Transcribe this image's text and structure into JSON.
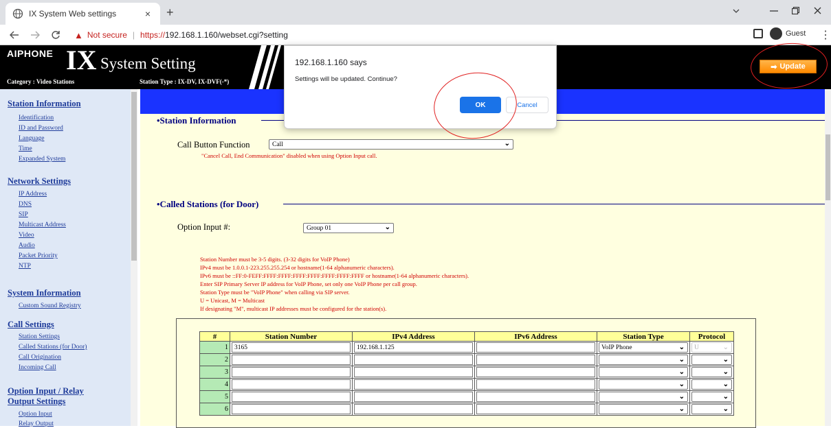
{
  "browser": {
    "tab_title": "IX System Web settings",
    "tab_close": "×",
    "new_tab": "+",
    "not_secure": "Not secure",
    "url_https": "https://",
    "url_rest": "192.168.1.160/webset.cgi?setting",
    "profile": "Guest",
    "icons": [
      "globe-icon",
      "back-icon",
      "forward-icon",
      "reload-icon",
      "warning-icon",
      "sidepanel-icon",
      "profile-icon",
      "menu-icon",
      "minimize-icon",
      "restore-icon",
      "close-icon",
      "dropdown-icon"
    ]
  },
  "header": {
    "brand": "AIPHONE",
    "product": "IX",
    "title": "System Setting",
    "category": "Category : Video Stations",
    "station_type": "Station Type : IX-DV, IX-DVF(-*)",
    "update_label": "Update"
  },
  "sidebar": {
    "sections": [
      {
        "title": "Station Information",
        "items": [
          "Identification",
          "ID and Password",
          "Language",
          "Time",
          "Expanded System"
        ]
      },
      {
        "title": "Network Settings",
        "items": [
          "IP Address",
          "DNS",
          "SIP",
          "Multicast Address",
          "Video",
          "Audio",
          "Packet Priority",
          "NTP"
        ]
      },
      {
        "title": "System Information",
        "items": [
          "Custom Sound Registry"
        ]
      },
      {
        "title": "Call Settings",
        "items": [
          "Station Settings",
          "Called Stations (for Door)",
          "Call Origination",
          "Incoming Call"
        ]
      },
      {
        "title": "Option Input / Relay Output Settings",
        "title_lines": [
          "Option Input / Relay",
          "Output Settings"
        ],
        "items": [
          "Option Input",
          "Relay Output"
        ]
      }
    ]
  },
  "main": {
    "station_info_title": "•Station Information",
    "call_button_label": "Call Button Function",
    "call_button_value": "Call",
    "call_note": "\"Cancel Call, End Communication\" disabled when using Option Input call.",
    "called_title": "•Called Stations (for Door)",
    "option_input_label": "Option Input #:",
    "option_input_value": "Group 01",
    "notes": [
      "Station Number must be 3-5 digits. (3-32 digits for VoIP Phone)",
      "IPv4 must be 1.0.0.1-223.255.255.254 or hostname(1-64 alphanumeric characters).",
      "IPv6 must be ::FF:0-FEFF:FFFF:FFFF:FFFF:FFFF:FFFF:FFFF:FFFF or hostname(1-64 alphanumeric characters).",
      "Enter SIP Primary Server IP address for VoIP Phone, set only one VoIP Phone per call group.",
      "Station Type must be \"VoIP Phone\" when calling via SIP server.",
      "U = Unicast, M = Multicast",
      "If designating \"M\", multicast IP addresses must be configured for the station(s)."
    ],
    "table": {
      "headers": [
        "#",
        "Station Number",
        "IPv4 Address",
        "IPv6 Address",
        "Station Type",
        "Protocol"
      ],
      "rows": [
        {
          "n": "1",
          "station": "3165",
          "ipv4": "192.168.1.125",
          "ipv6": "",
          "type": "VoIP Phone",
          "protocol": "U"
        },
        {
          "n": "2",
          "station": "",
          "ipv4": "",
          "ipv6": "",
          "type": "",
          "protocol": ""
        },
        {
          "n": "3",
          "station": "",
          "ipv4": "",
          "ipv6": "",
          "type": "",
          "protocol": ""
        },
        {
          "n": "4",
          "station": "",
          "ipv4": "",
          "ipv6": "",
          "type": "",
          "protocol": ""
        },
        {
          "n": "5",
          "station": "",
          "ipv4": "",
          "ipv6": "",
          "type": "",
          "protocol": ""
        },
        {
          "n": "6",
          "station": "",
          "ipv4": "",
          "ipv6": "",
          "type": "",
          "protocol": ""
        }
      ]
    }
  },
  "dialog": {
    "title": "192.168.1.160 says",
    "message": "Settings will be updated. Continue?",
    "ok_label": "OK",
    "cancel_label": "Cancel"
  },
  "colors": {
    "annotation": "#e02020",
    "content_bg": "#ffffe0",
    "blue_bar": "#1a33ff",
    "link": "#1e3b9a",
    "accent": "#1a73e8"
  }
}
